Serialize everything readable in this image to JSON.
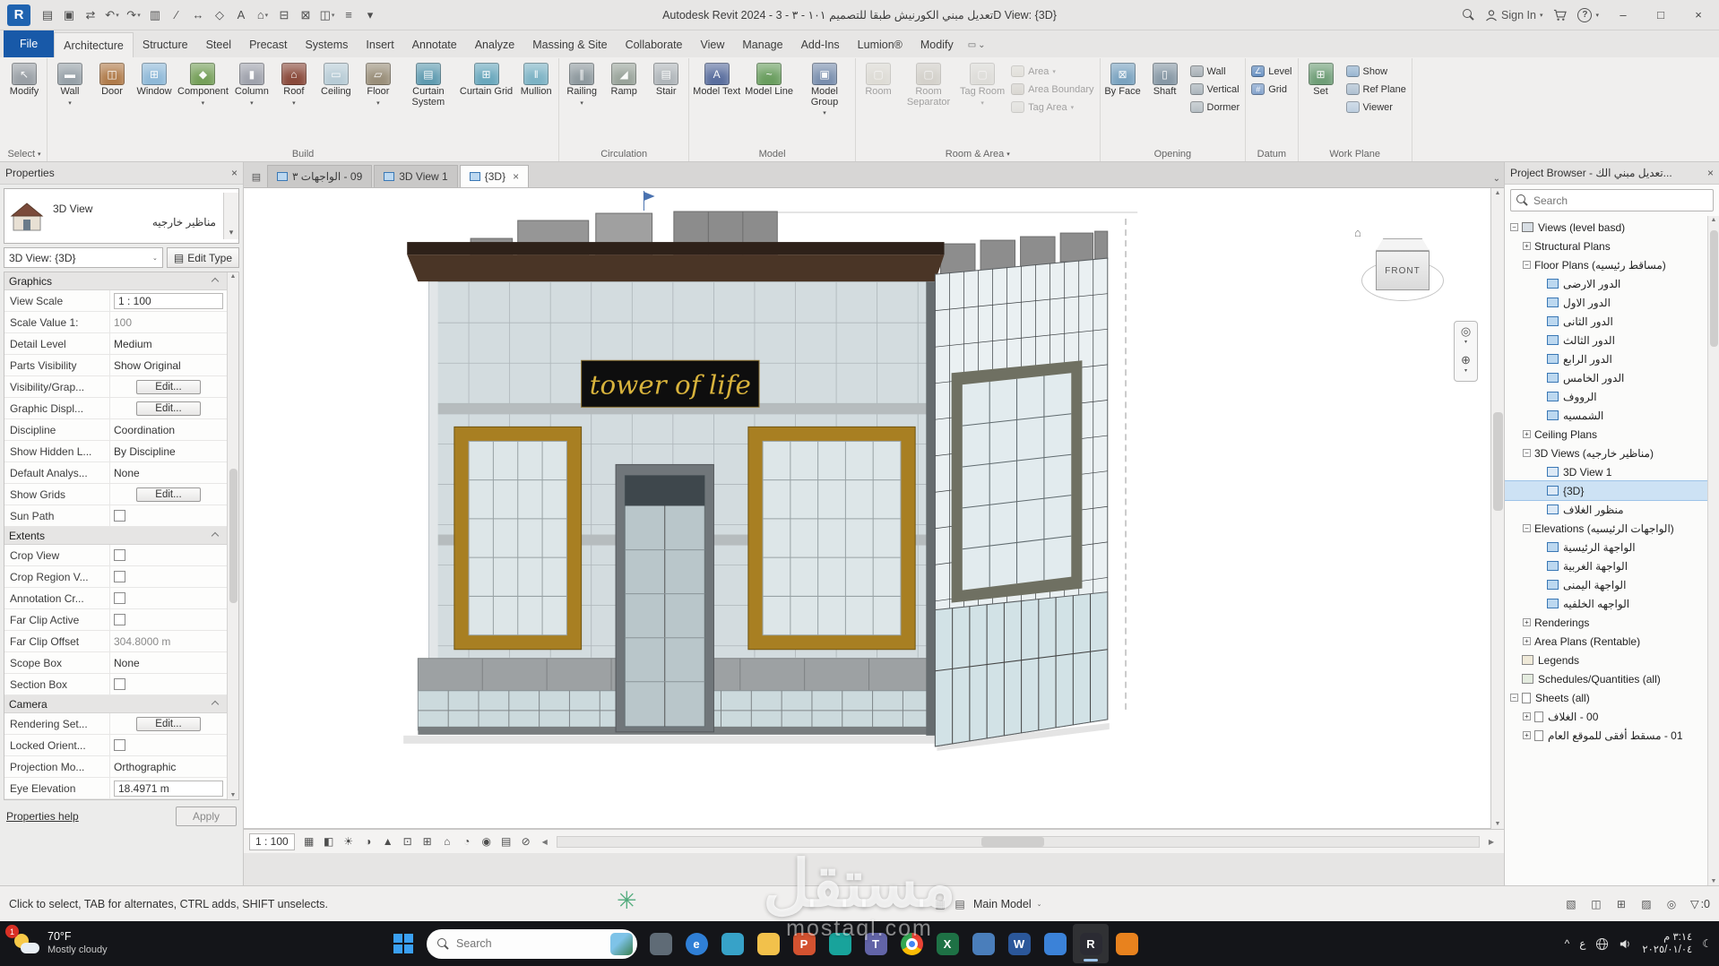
{
  "app": {
    "title": "Autodesk Revit 2024 - تعديل مبني الكورنيش طبقا للتصميم ١٠١ - ٣ - 3D View: {3D}"
  },
  "glyphs": {
    "dropdown": "▾",
    "caret": "⌄",
    "up": "▲",
    "down": "▼",
    "left": "◀",
    "right": "▶",
    "close": "×",
    "minimize": "–",
    "maximize": "□",
    "chevron_up": "^",
    "plus": "+",
    "minus": "−",
    "moon": "☾",
    "funnel": "▽",
    "home": "⌂",
    "panel": "▭",
    "page": "▤"
  },
  "title_bar": {
    "qat_icons": [
      {
        "name": "open-file-icon",
        "glyph": "▤"
      },
      {
        "name": "save-icon",
        "glyph": "▣"
      },
      {
        "name": "sync-with-central-icon",
        "glyph": "⇄"
      },
      {
        "name": "undo-icon",
        "glyph": "↶",
        "arrow": true
      },
      {
        "name": "redo-icon",
        "glyph": "↷",
        "arrow": true
      },
      {
        "name": "print-icon",
        "glyph": "▥"
      },
      {
        "name": "measure-icon",
        "glyph": "∕"
      },
      {
        "name": "aligned-dimension-icon",
        "glyph": "↔"
      },
      {
        "name": "tag-by-category-icon",
        "glyph": "◇"
      },
      {
        "name": "text-icon",
        "glyph": "A"
      },
      {
        "name": "default-3d-view-icon",
        "glyph": "⌂",
        "arrow": true
      },
      {
        "name": "section-icon",
        "glyph": "⊟"
      },
      {
        "name": "close-hidden-windows-icon",
        "glyph": "⊠"
      },
      {
        "name": "switch-windows-icon",
        "glyph": "◫",
        "arrow": true
      },
      {
        "name": "thin-lines-icon",
        "glyph": "≡"
      },
      {
        "name": "customize-qat-icon",
        "glyph": "▾"
      }
    ],
    "sign_in": "Sign In",
    "help": "?"
  },
  "ribbon": {
    "file_tab": "File",
    "tabs": [
      {
        "label": "Architecture",
        "active": true
      },
      {
        "label": "Structure"
      },
      {
        "label": "Steel"
      },
      {
        "label": "Precast"
      },
      {
        "label": "Systems"
      },
      {
        "label": "Insert"
      },
      {
        "label": "Annotate"
      },
      {
        "label": "Analyze"
      },
      {
        "label": "Massing & Site"
      },
      {
        "label": "Collaborate"
      },
      {
        "label": "View"
      },
      {
        "label": "Manage"
      },
      {
        "label": "Add-Ins"
      },
      {
        "label": "Lumion®"
      },
      {
        "label": "Modify"
      }
    ],
    "panels": [
      {
        "label": "Select",
        "arrow": true,
        "groups": [
          {
            "layout": "big",
            "buttons": [
              {
                "label": "Modify",
                "color": "#9aa0a6",
                "glyph": "↖"
              }
            ]
          }
        ]
      },
      {
        "label": "Build",
        "groups": [
          {
            "layout": "big",
            "buttons": [
              {
                "label": "Wall",
                "color": "#97a1a8",
                "glyph": "▬",
                "arrow": true
              },
              {
                "label": "Door",
                "color": "#b07b4a",
                "glyph": "◫"
              },
              {
                "label": "Window",
                "color": "#8fb9d8",
                "glyph": "⊞"
              },
              {
                "label": "Component",
                "color": "#76a05a",
                "glyph": "◆",
                "arrow": true
              },
              {
                "label": "Column",
                "color": "#a0a3ad",
                "glyph": "▮",
                "arrow": true
              },
              {
                "label": "Roof",
                "color": "#8a4a3b",
                "glyph": "⌂",
                "arrow": true
              },
              {
                "label": "Ceiling",
                "color": "#b8ccd6",
                "glyph": "▭"
              },
              {
                "label": "Floor",
                "color": "#9a8f7a",
                "glyph": "▱",
                "arrow": true
              },
              {
                "label": "Curtain System",
                "color": "#5f9bb0",
                "glyph": "▤"
              },
              {
                "label": "Curtain Grid",
                "color": "#6aa8bd",
                "glyph": "⊞"
              },
              {
                "label": "Mullion",
                "color": "#7db3c5",
                "glyph": "‖"
              }
            ]
          }
        ]
      },
      {
        "label": "Circulation",
        "groups": [
          {
            "layout": "big",
            "buttons": [
              {
                "label": "Railing",
                "color": "#8f9a9f",
                "glyph": "∥",
                "arrow": true
              },
              {
                "label": "Ramp",
                "color": "#9aa49b",
                "glyph": "◢"
              },
              {
                "label": "Stair",
                "color": "#b0b6ba",
                "glyph": "▤"
              }
            ]
          }
        ]
      },
      {
        "label": "Model",
        "groups": [
          {
            "layout": "big",
            "buttons": [
              {
                "label": "Model Text",
                "color": "#5a6e9e",
                "glyph": "A"
              },
              {
                "label": "Model Line",
                "color": "#6a9e5f",
                "glyph": "~"
              },
              {
                "label": "Model Group",
                "color": "#7a8fae",
                "glyph": "▣",
                "arrow": true
              }
            ]
          }
        ]
      },
      {
        "label": "Room & Area",
        "arrow": true,
        "groups": [
          {
            "layout": "big",
            "buttons": [
              {
                "label": "Room",
                "color": "#d8c56a",
                "glyph": "▢",
                "disabled": true
              },
              {
                "label": "Room Separator",
                "color": "#c9a94f",
                "glyph": "▢",
                "disabled": true
              },
              {
                "label": "Tag Room",
                "color": "#cdc793",
                "glyph": "▢",
                "arrow": true,
                "disabled": true
              }
            ]
          },
          {
            "layout": "stack",
            "buttons": [
              {
                "label": "Area",
                "color": "#d8c56a",
                "arrow": true,
                "disabled": true
              },
              {
                "label": "Area Boundary",
                "color": "#c9a94f",
                "disabled": true
              },
              {
                "label": "Tag Area",
                "color": "#cdc793",
                "arrow": true,
                "disabled": true
              }
            ]
          }
        ]
      },
      {
        "label": "Opening",
        "groups": [
          {
            "layout": "big",
            "buttons": [
              {
                "label": "By Face",
                "color": "#7aa3c0",
                "glyph": "⊠"
              },
              {
                "label": "Shaft",
                "color": "#8899a6",
                "glyph": "▯"
              }
            ]
          },
          {
            "layout": "stack",
            "buttons": [
              {
                "label": "Wall",
                "color": "#97a1a8"
              },
              {
                "label": "Vertical",
                "color": "#9aa6ae"
              },
              {
                "label": "Dormer",
                "color": "#a8b2b8"
              }
            ]
          }
        ]
      },
      {
        "label": "Datum",
        "groups": [
          {
            "layout": "stack",
            "buttons": [
              {
                "label": "Level",
                "color": "#4a7ab5",
                "glyph": "∠"
              },
              {
                "label": "Grid",
                "color": "#6a8fc0",
                "glyph": "#"
              }
            ]
          }
        ]
      },
      {
        "label": "Work Plane",
        "groups": [
          {
            "layout": "big",
            "buttons": [
              {
                "label": "Set",
                "color": "#6f9e77",
                "glyph": "⊞"
              }
            ]
          },
          {
            "layout": "stack",
            "buttons": [
              {
                "label": "Show",
                "color": "#86a8c8"
              },
              {
                "label": "Ref Plane",
                "color": "#9fb4c8"
              },
              {
                "label": "Viewer",
                "color": "#b0c4d8"
              }
            ]
          }
        ]
      }
    ]
  },
  "properties": {
    "header": "Properties",
    "selector": {
      "line1": "3D View",
      "line2": "مناظير خارجيه"
    },
    "instance": "3D View: {3D}",
    "edit_type": "Edit Type",
    "groups": [
      {
        "name": "Graphics",
        "rows": [
          {
            "label": "View Scale",
            "value": "1 : 100",
            "kind": "input"
          },
          {
            "label": "Scale Value 1:",
            "value": "100",
            "kind": "disabled"
          },
          {
            "label": "Detail Level",
            "value": "Medium",
            "kind": "text"
          },
          {
            "label": "Parts Visibility",
            "value": "Show Original",
            "kind": "text"
          },
          {
            "label": "Visibility/Grap...",
            "value": "Edit...",
            "kind": "button"
          },
          {
            "label": "Graphic Displ...",
            "value": "Edit...",
            "kind": "button"
          },
          {
            "label": "Discipline",
            "value": "Coordination",
            "kind": "text"
          },
          {
            "label": "Show Hidden L...",
            "value": "By Discipline",
            "kind": "text"
          },
          {
            "label": "Default Analys...",
            "value": "None",
            "kind": "text"
          },
          {
            "label": "Show Grids",
            "value": "Edit...",
            "kind": "button"
          },
          {
            "label": "Sun Path",
            "value": "",
            "kind": "checkbox"
          }
        ]
      },
      {
        "name": "Extents",
        "rows": [
          {
            "label": "Crop View",
            "value": "",
            "kind": "checkbox"
          },
          {
            "label": "Crop Region V...",
            "value": "",
            "kind": "checkbox"
          },
          {
            "label": "Annotation Cr...",
            "value": "",
            "kind": "checkbox"
          },
          {
            "label": "Far Clip Active",
            "value": "",
            "kind": "checkbox"
          },
          {
            "label": "Far Clip Offset",
            "value": "304.8000 m",
            "kind": "disabled"
          },
          {
            "label": "Scope Box",
            "value": "None",
            "kind": "text"
          },
          {
            "label": "Section Box",
            "value": "",
            "kind": "checkbox"
          }
        ]
      },
      {
        "name": "Camera",
        "rows": [
          {
            "label": "Rendering Set...",
            "value": "Edit...",
            "kind": "button"
          },
          {
            "label": "Locked Orient...",
            "value": "",
            "kind": "checkbox"
          },
          {
            "label": "Projection Mo...",
            "value": "Orthographic",
            "kind": "text"
          },
          {
            "label": "Eye Elevation",
            "value": "18.4971 m",
            "kind": "input"
          }
        ]
      }
    ],
    "help": "Properties help",
    "apply": "Apply"
  },
  "view_tabs": {
    "tabs": [
      {
        "label": "09 - الواجهات ٣",
        "rtl": true
      },
      {
        "label": "3D View 1"
      },
      {
        "label": "{3D}",
        "active": true
      }
    ]
  },
  "canvas": {
    "sign_text": "tower of life",
    "viewcube_label": "FRONT",
    "scale_label": "1 : 100",
    "view_control_icons": [
      {
        "name": "detail-level-icon",
        "glyph": "▦"
      },
      {
        "name": "visual-style-icon",
        "glyph": "◧"
      },
      {
        "name": "sun-path-toggle-icon",
        "glyph": "☀"
      },
      {
        "name": "shadows-toggle-icon",
        "glyph": "◑"
      },
      {
        "name": "show-rendering-dialog-icon",
        "glyph": "▲"
      },
      {
        "name": "crop-view-icon",
        "glyph": "⊡"
      },
      {
        "name": "show-crop-region-icon",
        "glyph": "⊞"
      },
      {
        "name": "unlocked-3d-view-icon",
        "glyph": "⌂"
      },
      {
        "name": "temporary-hide-isolate-icon",
        "glyph": "◔"
      },
      {
        "name": "reveal-hidden-elements-icon",
        "glyph": "◉"
      },
      {
        "name": "temporary-view-properties-icon",
        "glyph": "▤"
      },
      {
        "name": "show-constraints-icon",
        "glyph": "⊘"
      }
    ],
    "navbar_icons": [
      {
        "name": "full-navigation-wheel-icon",
        "glyph": "◎"
      },
      {
        "name": "pan-icon",
        "glyph": "⊕"
      }
    ]
  },
  "project_browser": {
    "title": "Project Browser - تعديل مبني الك...",
    "search_placeholder": "Search",
    "tree": [
      {
        "label": "Views (level basd)",
        "depth": 0,
        "expand": "minus",
        "icon": "views"
      },
      {
        "label": "Structural Plans",
        "depth": 1,
        "expand": "plus"
      },
      {
        "label": "Floor Plans (مساقط رئيسيه)",
        "depth": 1,
        "expand": "minus"
      },
      {
        "label": "الدور الارضى",
        "depth": 2,
        "icon": "plan"
      },
      {
        "label": "الدور الاول",
        "depth": 2,
        "icon": "plan"
      },
      {
        "label": "الدور الثانى",
        "depth": 2,
        "icon": "plan"
      },
      {
        "label": "الدور الثالث",
        "depth": 2,
        "icon": "plan"
      },
      {
        "label": "الدور الرابع",
        "depth": 2,
        "icon": "plan"
      },
      {
        "label": "الدور الخامس",
        "depth": 2,
        "icon": "plan"
      },
      {
        "label": "الرووف",
        "depth": 2,
        "icon": "plan"
      },
      {
        "label": "الشمسيه",
        "depth": 2,
        "icon": "plan"
      },
      {
        "label": "Ceiling Plans",
        "depth": 1,
        "expand": "plus"
      },
      {
        "label": "3D Views (مناظير خارجيه)",
        "depth": 1,
        "expand": "minus"
      },
      {
        "label": "3D View 1",
        "depth": 2,
        "icon": "v3d"
      },
      {
        "label": "{3D}",
        "depth": 2,
        "icon": "v3d",
        "selected": true
      },
      {
        "label": "منظور الغلاف",
        "depth": 2,
        "icon": "v3d"
      },
      {
        "label": "Elevations (الواجهات الرئيسيه)",
        "depth": 1,
        "expand": "minus"
      },
      {
        "label": "الواجهة الرئيسية",
        "depth": 2,
        "icon": "plan"
      },
      {
        "label": "الواجهة الغربية",
        "depth": 2,
        "icon": "plan"
      },
      {
        "label": "الواجهة اليمنى",
        "depth": 2,
        "icon": "plan"
      },
      {
        "label": "الواجهه الخلفيه",
        "depth": 2,
        "icon": "plan"
      },
      {
        "label": "Renderings",
        "depth": 1,
        "expand": "plus"
      },
      {
        "label": "Area Plans (Rentable)",
        "depth": 1,
        "expand": "plus"
      },
      {
        "label": "Legends",
        "depth": 0,
        "icon": "legend"
      },
      {
        "label": "Schedules/Quantities (all)",
        "depth": 0,
        "icon": "schedule"
      },
      {
        "label": "Sheets (all)",
        "depth": 0,
        "expand": "minus",
        "icon": "sheet"
      },
      {
        "label": "00 - الغلاف",
        "depth": 1,
        "expand": "plus",
        "icon": "sheet",
        "rtl": true
      },
      {
        "label": "01 - مسقط أفقى للموقع العام",
        "depth": 1,
        "expand": "plus",
        "icon": "sheet",
        "rtl": true
      }
    ]
  },
  "status_bar": {
    "hint": "Click to select, TAB for alternates, CTRL adds, SHIFT unselects.",
    "main_model": "Main Model",
    "filter_count": ":0",
    "center_icons": [
      {
        "name": "worksets-status-icon",
        "glyph": "▦"
      },
      {
        "name": "design-options-status-icon",
        "glyph": "▤"
      }
    ],
    "right_icons": [
      {
        "name": "editable-only-icon",
        "glyph": "▧"
      },
      {
        "name": "workset-toggle-icon",
        "glyph": "◫"
      },
      {
        "name": "design-option-toggle-icon",
        "glyph": "⊞"
      },
      {
        "name": "exclude-options-icon",
        "glyph": "▨"
      },
      {
        "name": "press-drag-icon",
        "glyph": "◎"
      }
    ]
  },
  "taskbar": {
    "weather_temp": "70°F",
    "weather_desc": "Mostly cloudy",
    "badge": "1",
    "search_placeholder": "Search",
    "apps": [
      {
        "name": "taskbar-app-files",
        "color": "#5f6b76"
      },
      {
        "name": "taskbar-app-edge",
        "color": "#2f7fd6",
        "glyph": "e",
        "round": true
      },
      {
        "name": "taskbar-app-store",
        "color": "#37a2c8"
      },
      {
        "name": "taskbar-app-file-explorer",
        "color": "#f2c14b"
      },
      {
        "name": "taskbar-app-powerpoint",
        "color": "#d35230",
        "glyph": "P"
      },
      {
        "name": "taskbar-app-snipping",
        "color": "#18a39b"
      },
      {
        "name": "taskbar-app-teams",
        "color": "#6264a7",
        "glyph": "T"
      },
      {
        "name": "taskbar-app-chrome",
        "chrome": true
      },
      {
        "name": "taskbar-app-excel",
        "color": "#1e7145",
        "glyph": "X"
      },
      {
        "name": "taskbar-app-calculator",
        "color": "#4a7ebb"
      },
      {
        "name": "taskbar-app-word",
        "color": "#2b579a",
        "glyph": "W"
      },
      {
        "name": "taskbar-app-photos",
        "color": "#3b82d8"
      },
      {
        "name": "taskbar-app-revit",
        "color": "#2b2b33",
        "glyph": "R",
        "active": true
      },
      {
        "name": "taskbar-app-epic",
        "color": "#e8821e"
      }
    ],
    "tray": {
      "language": "ع",
      "time": "٣:١٤ م",
      "date": "٢٠٢٥/٠١/٠٤"
    }
  },
  "watermark": {
    "text": "مستقل",
    "subtext": "mostaql.com",
    "logo_glyph": "✳"
  }
}
